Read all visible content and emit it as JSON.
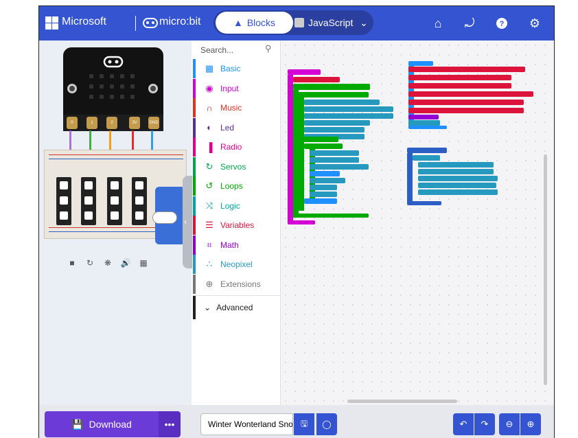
{
  "header": {
    "brand": "Microsoft",
    "product": "micro:bit",
    "tabs": {
      "blocks": "Blocks",
      "javascript": "JavaScript"
    },
    "accent": "#3454d1"
  },
  "toolbox": {
    "search_placeholder": "Search...",
    "categories": [
      {
        "label": "Basic",
        "color": "#1e90ff",
        "icon": "grid-icon"
      },
      {
        "label": "Input",
        "color": "#d400d4",
        "icon": "target-icon"
      },
      {
        "label": "Music",
        "color": "#e63022",
        "icon": "headphones-icon"
      },
      {
        "label": "Led",
        "color": "#5c2d91",
        "icon": "toggle-icon"
      },
      {
        "label": "Radio",
        "color": "#e3008c",
        "icon": "signal-icon"
      },
      {
        "label": "Servos",
        "color": "#00a64d",
        "icon": "rotate-icon"
      },
      {
        "label": "Loops",
        "color": "#00aa00",
        "icon": "loop-icon"
      },
      {
        "label": "Logic",
        "color": "#00a4a6",
        "icon": "shuffle-icon"
      },
      {
        "label": "Variables",
        "color": "#dc143c",
        "icon": "lines-icon"
      },
      {
        "label": "Math",
        "color": "#9400d3",
        "icon": "calculator-icon"
      },
      {
        "label": "Neopixel",
        "color": "#2699bf",
        "icon": "dots-icon"
      },
      {
        "label": "Extensions",
        "color": "#777777",
        "icon": "plus-icon"
      }
    ],
    "advanced": "Advanced"
  },
  "footer": {
    "download": "Download",
    "project_name": "Winter Wonterland Snov"
  }
}
